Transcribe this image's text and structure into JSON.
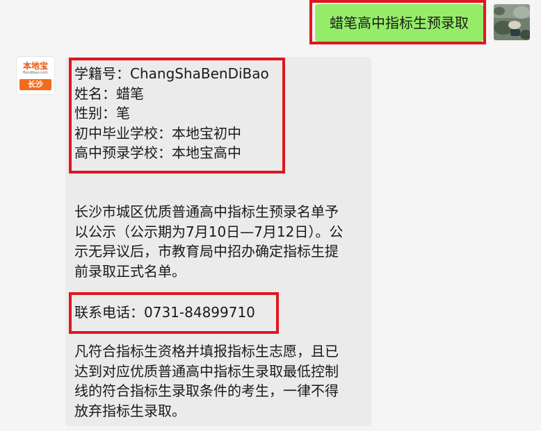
{
  "outgoing": {
    "text": "蜡笔高中指标生预录取"
  },
  "incoming": {
    "avatar": {
      "brand": "本地宝",
      "url": "Bendibao.com",
      "city": "长沙"
    },
    "info": [
      "学籍号：ChangShaBenDiBao",
      "姓名：蜡笔",
      "性别：笔",
      "初中毕业学校：本地宝初中",
      "高中预录学校：本地宝高中"
    ],
    "notice": [
      "长沙市城区优质普通高中指标生预录名单予",
      "以公示（公示期为7月10日—7月12日）。公",
      "示无异议后，市教育局中招办确定指标生提",
      "前录取正式名单。"
    ],
    "phone": "联系电话：0731-84899710",
    "rules": [
      "凡符合指标生资格并填报指标生志愿，且已",
      "达到对应优质普通高中指标生录取最低控制",
      "线的符合指标生录取条件的考生，一律不得",
      "放弃指标生录取。"
    ]
  },
  "colors": {
    "outgoing_bubble": "#95ec69",
    "incoming_bubble": "#ebebeb",
    "highlight": "#e0161e",
    "background": "#f5f5f5"
  }
}
